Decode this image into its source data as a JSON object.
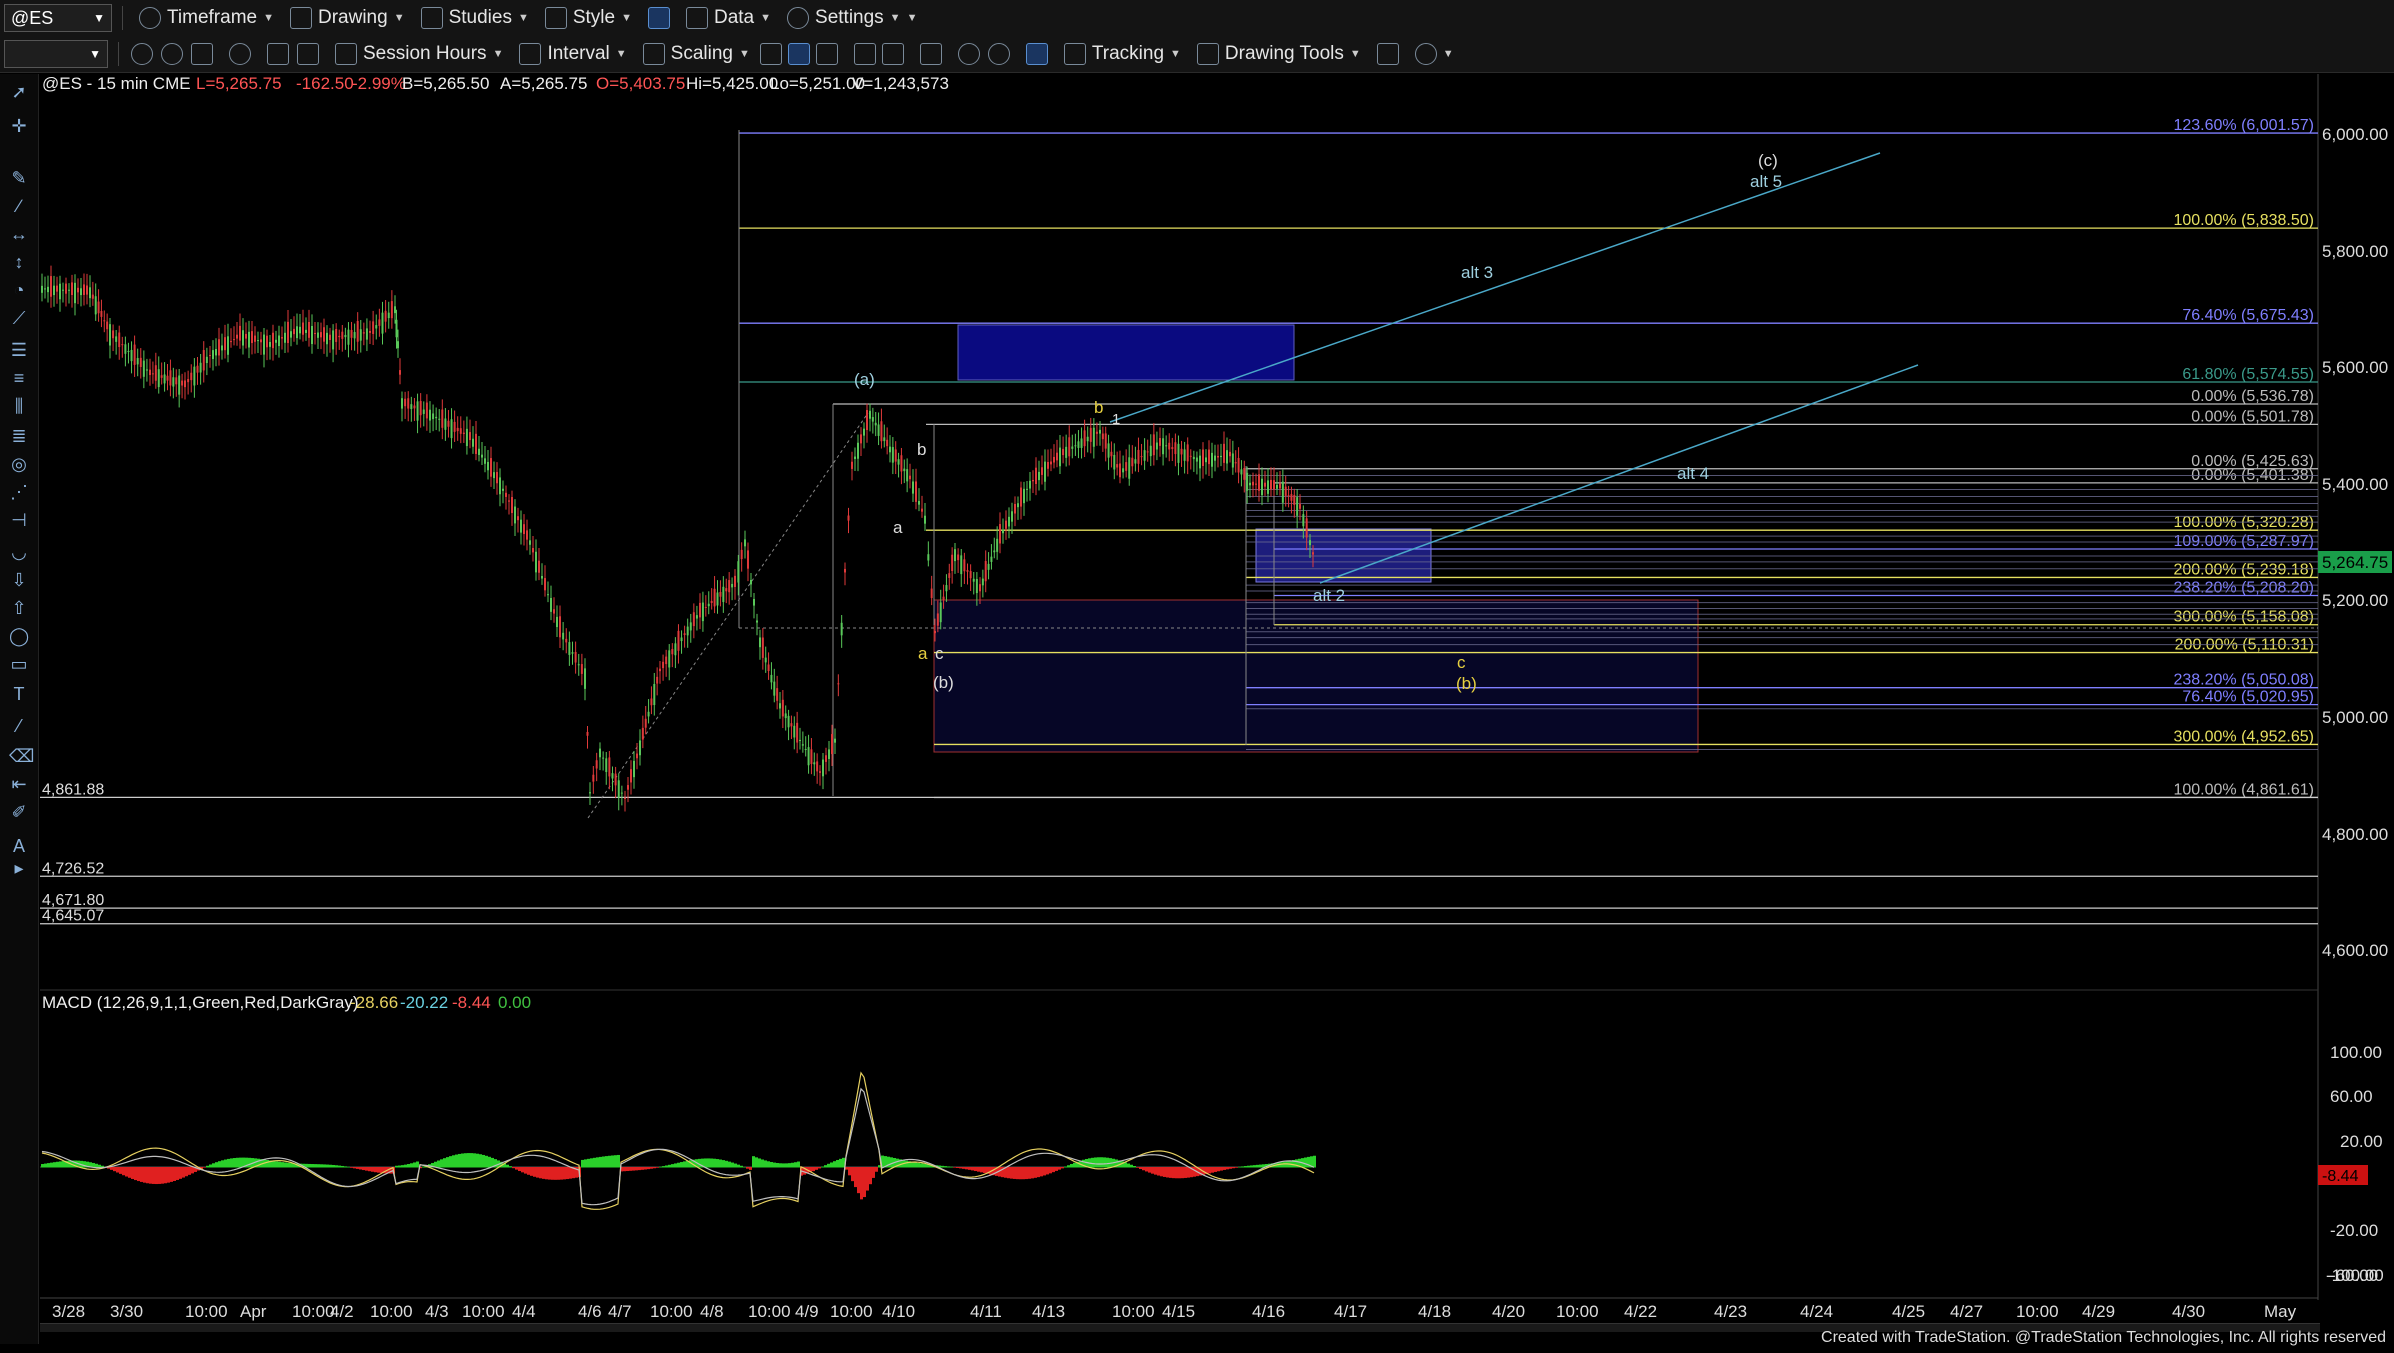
{
  "toolbar1": {
    "symbol": "@ES",
    "timeframe": "Timeframe",
    "drawing": "Drawing",
    "studies": "Studies",
    "style": "Style",
    "data": "Data",
    "settings": "Settings"
  },
  "toolbar2": {
    "session_hours": "Session Hours",
    "interval": "Interval",
    "scaling": "Scaling",
    "tracking": "Tracking",
    "drawing_tools": "Drawing Tools"
  },
  "header": {
    "symbol_info": "@ES - 15 min  CME",
    "last": "L=5,265.75",
    "net_change": "-162.50",
    "pct_change": "-2.99%",
    "bid": "B=5,265.50",
    "ask": "A=5,265.75",
    "open": "O=5,403.75",
    "high": "Hi=5,425.00",
    "low": "Lo=5,251.00",
    "volume": "V=1,243,573"
  },
  "price_axis": [
    "6,000.00",
    "5,800.00",
    "5,600.00",
    "5,400.00",
    "5,200.00",
    "5,000.00",
    "4,800.00",
    "4,600.00"
  ],
  "last_price_tag": "5,264.75",
  "fib_levels": [
    {
      "label": "123.60% (6,001.57)",
      "price": 6001.57,
      "color": "#7f7fff"
    },
    {
      "label": "100.00% (5,838.50)",
      "price": 5838.5,
      "color": "#e6e060"
    },
    {
      "label": "76.40% (5,675.43)",
      "price": 5675.43,
      "color": "#7f7fff"
    },
    {
      "label": "61.80% (5,574.55)",
      "price": 5574.55,
      "color": "#3a9a8a"
    },
    {
      "label": "0.00% (5,536.78)",
      "price": 5536.78,
      "color": "#bbbbbb"
    },
    {
      "label": "0.00% (5,501.78)",
      "price": 5501.78,
      "color": "#bbbbbb"
    },
    {
      "label": "0.00% (5,425.63)",
      "price": 5425.63,
      "color": "#bbbbbb"
    },
    {
      "label": "0.00% (5,401.38)",
      "price": 5401.38,
      "color": "#bbbbbb"
    },
    {
      "label": "100.00% (5,320.28)",
      "price": 5320.28,
      "color": "#e6e060"
    },
    {
      "label": "109.00% (5,287.97)",
      "price": 5287.97,
      "color": "#7f7fff"
    },
    {
      "label": "200.00% (5,239.18)",
      "price": 5239.18,
      "color": "#e6e060"
    },
    {
      "label": "238.20% (5,208.20)",
      "price": 5208.2,
      "color": "#7f7fff"
    },
    {
      "label": "300.00% (5,158.08)",
      "price": 5158.08,
      "color": "#e6e060"
    },
    {
      "label": "200.00% (5,110.31)",
      "price": 5110.31,
      "color": "#e6e060"
    },
    {
      "label": "238.20% (5,050.08)",
      "price": 5050.08,
      "color": "#7f7fff"
    },
    {
      "label": "76.40% (5,020.95)",
      "price": 5020.95,
      "color": "#7f7fff"
    },
    {
      "label": "300.00% (4,952.65)",
      "price": 4952.65,
      "color": "#e6e060"
    },
    {
      "label": "100.00% (4,861.61)",
      "price": 4861.61,
      "color": "#bbbbbb"
    }
  ],
  "left_levels": [
    {
      "label": "4,861.88",
      "price": 4861.88
    },
    {
      "label": "4,726.52",
      "price": 4726.52
    },
    {
      "label": "4,671.80",
      "price": 4671.8
    },
    {
      "label": "4,645.07",
      "price": 4645.07
    }
  ],
  "wave_labels": [
    {
      "text": "(c)",
      "color": "#dddddd"
    },
    {
      "text": "alt 5",
      "color": "#9fd0e0"
    },
    {
      "text": "alt 3",
      "color": "#9fd0e0"
    },
    {
      "text": "(a)",
      "color": "#9fd0e0"
    },
    {
      "text": "b",
      "color": "#e6d040"
    },
    {
      "text": "1",
      "color": "#dddddd"
    },
    {
      "text": "b",
      "color": "#dddddd"
    },
    {
      "text": "a",
      "color": "#dddddd"
    },
    {
      "text": "alt 4",
      "color": "#9fd0e0"
    },
    {
      "text": "alt 2",
      "color": "#9fd0e0"
    },
    {
      "text": "a",
      "color": "#e6d040"
    },
    {
      "text": "c",
      "color": "#dddddd"
    },
    {
      "text": "(b)",
      "color": "#dddddd"
    },
    {
      "text": "c",
      "color": "#e6d040"
    },
    {
      "text": "(b)",
      "color": "#e6d040"
    }
  ],
  "macd": {
    "label": "MACD (12,26,9,1,1,Green,Red,DarkGray)",
    "v1": "-28.66",
    "v2": "-20.22",
    "v3": "-8.44",
    "v4": "0.00",
    "axis": [
      "100.00",
      "60.00",
      "20.00",
      "-20.00",
      "-60.00",
      "-100.00"
    ],
    "tag": "-8.44"
  },
  "time_axis": [
    "3/28",
    "3/30",
    "10:00",
    "Apr",
    "10:00",
    "4/2",
    "10:00",
    "4/3",
    "10:00",
    "4/4",
    "4/6",
    "4/7",
    "10:00",
    "4/8",
    "10:00",
    "4/9",
    "10:00",
    "4/10",
    "4/11",
    "4/13",
    "10:00",
    "4/15",
    "4/16",
    "4/17",
    "4/18",
    "4/20",
    "10:00",
    "4/22",
    "4/23",
    "4/24",
    "4/25",
    "4/27",
    "10:00",
    "4/29",
    "4/30",
    "May"
  ],
  "footer": "Created with TradeStation. @TradeStation Technologies, Inc. All rights reserved"
}
